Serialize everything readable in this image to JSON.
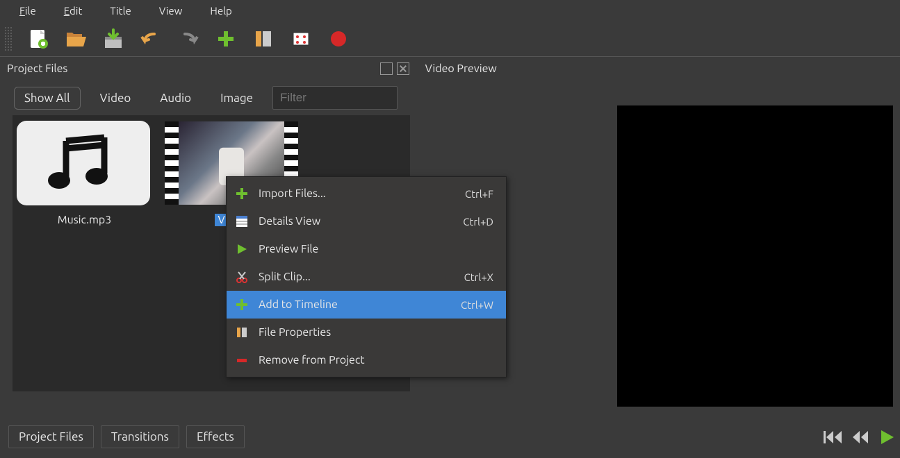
{
  "menubar": {
    "file": "File",
    "edit": "Edit",
    "title": "Title",
    "view": "View",
    "help": "Help"
  },
  "panels": {
    "project_files": "Project Files",
    "video_preview": "Video Preview"
  },
  "filter_tabs": {
    "show_all": "Show All",
    "video": "Video",
    "audio": "Audio",
    "image": "Image"
  },
  "filter_placeholder": "Filter",
  "files": {
    "music": "Music.mp3",
    "video": "Video"
  },
  "bottom_tabs": {
    "project_files": "Project Files",
    "transitions": "Transitions",
    "effects": "Effects"
  },
  "context_menu": {
    "import_files": {
      "label": "Import Files...",
      "shortcut": "Ctrl+F"
    },
    "details_view": {
      "label": "Details View",
      "shortcut": "Ctrl+D"
    },
    "preview_file": {
      "label": "Preview File",
      "shortcut": ""
    },
    "split_clip": {
      "label": "Split Clip...",
      "shortcut": "Ctrl+X"
    },
    "add_to_timeline": {
      "label": "Add to Timeline",
      "shortcut": "Ctrl+W"
    },
    "file_properties": {
      "label": "File Properties",
      "shortcut": ""
    },
    "remove_from_project": {
      "label": "Remove from Project",
      "shortcut": ""
    }
  }
}
